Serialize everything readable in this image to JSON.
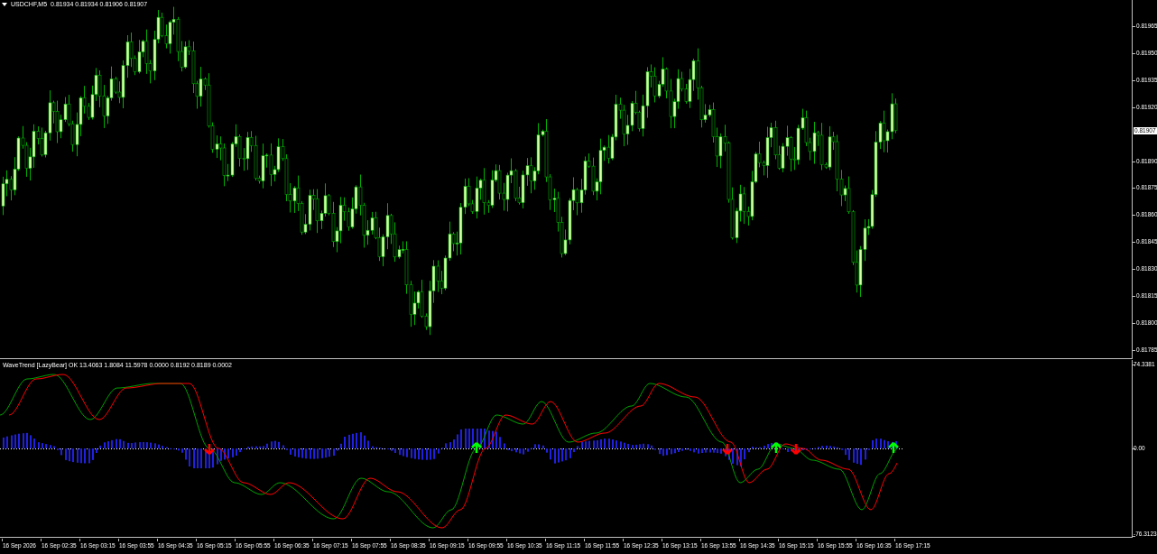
{
  "chart": {
    "symbol": "USDCHF,M5",
    "ohlc": "0.81934 0.81934 0.81906 0.81907",
    "current_price": "0.81907",
    "price_axis": [
      "0.81965",
      "0.81950",
      "0.81935",
      "0.81920",
      "0.81890",
      "0.81875",
      "0.81860",
      "0.81845",
      "0.81830",
      "0.81815",
      "0.81800",
      "0.81785"
    ]
  },
  "indicator": {
    "label": "WaveTrend [LazyBear] OK 13.4063 1.8084 11.5978 0.0000 0.8192 0.8189 0.0002",
    "axis": [
      "74.3381",
      "0.00",
      "-76.3123"
    ]
  },
  "time_axis": [
    "16 Sep 2026",
    "16 Sep 02:35",
    "16 Sep 03:15",
    "16 Sep 03:55",
    "16 Sep 04:35",
    "16 Sep 05:15",
    "16 Sep 05:55",
    "16 Sep 06:35",
    "16 Sep 07:15",
    "16 Sep 07:55",
    "16 Sep 08:35",
    "16 Sep 09:15",
    "16 Sep 09:55",
    "16 Sep 10:35",
    "16 Sep 11:15",
    "16 Sep 11:55",
    "16 Sep 12:35",
    "16 Sep 13:15",
    "16 Sep 13:55",
    "16 Sep 14:35",
    "16 Sep 15:15",
    "16 Sep 15:55",
    "16 Sep 16:35",
    "16 Sep 17:15"
  ]
}
